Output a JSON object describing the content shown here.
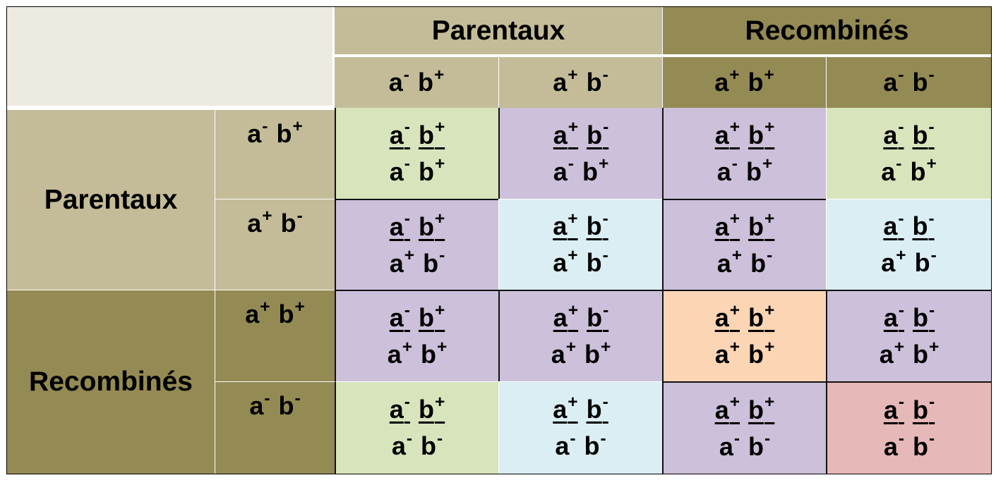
{
  "colors": {
    "corner": "#EDEBE0",
    "parental_header": "#C4BC98",
    "recombinant_header": "#948A54",
    "green": "#D8E4BC",
    "purple": "#CCC0DA",
    "blue": "#DAEEF3",
    "orange": "#FCD5B4",
    "pink": "#E6B8B7"
  },
  "headers": {
    "parentaux": "Parentaux",
    "recombines": "Recombinés"
  },
  "labels": {
    "a": "a",
    "b": "b",
    "minus": "-",
    "plus": "+"
  },
  "gametes": [
    {
      "a": "-",
      "b": "+"
    },
    {
      "a": "+",
      "b": "-"
    },
    {
      "a": "+",
      "b": "+"
    },
    {
      "a": "-",
      "b": "-"
    }
  ],
  "matrix_colors": [
    [
      "green",
      "purple",
      "purple",
      "green"
    ],
    [
      "purple",
      "blue",
      "purple",
      "blue"
    ],
    [
      "purple",
      "purple",
      "orange",
      "purple"
    ],
    [
      "green",
      "blue",
      "purple",
      "pink"
    ]
  ]
}
